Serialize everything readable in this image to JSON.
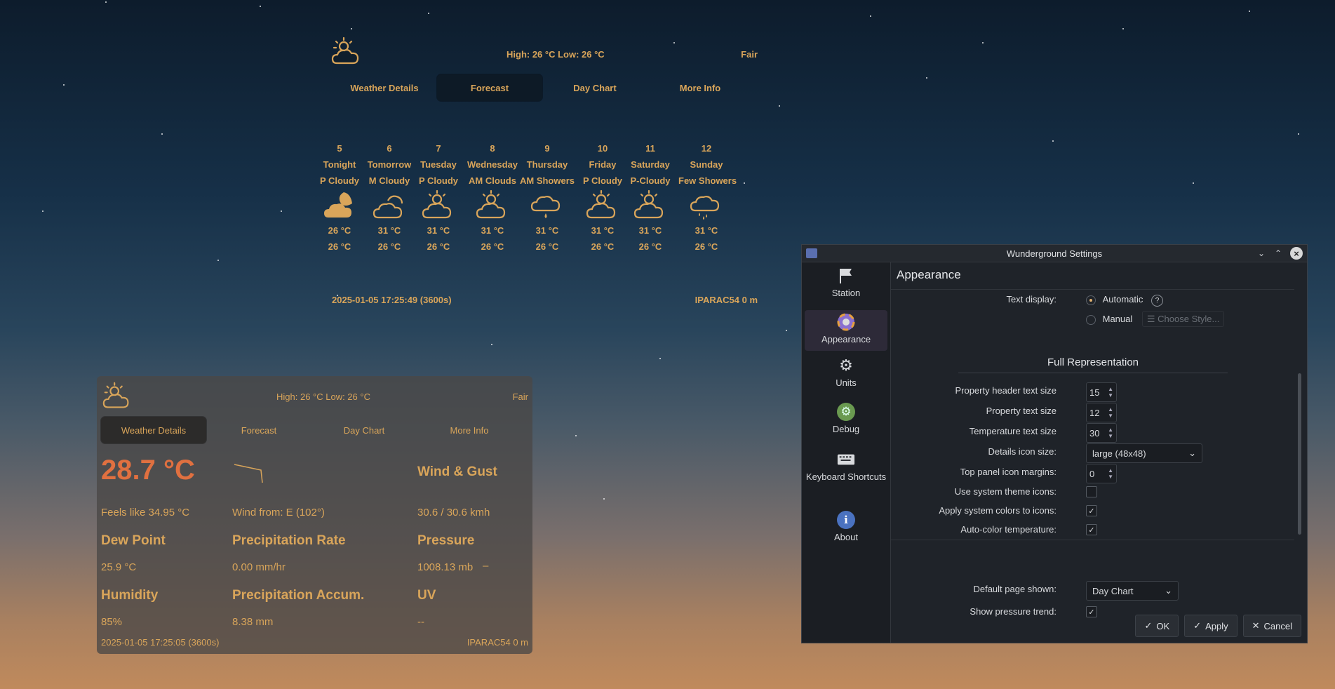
{
  "forecast_panel": {
    "hilo": "High: 26 °C Low: 26 °C",
    "condition": "Fair",
    "tabs": [
      "Weather Details",
      "Forecast",
      "Day Chart",
      "More Info"
    ],
    "active_tab": "Forecast",
    "days": [
      {
        "date": "5",
        "name": "Tonight",
        "cond": "P Cloudy",
        "icon": "moon-cloud-icon",
        "high": "26 °C",
        "low": "26 °C"
      },
      {
        "date": "6",
        "name": "Tomorrow",
        "cond": "M Cloudy",
        "icon": "clouds-icon",
        "high": "31 °C",
        "low": "26 °C"
      },
      {
        "date": "7",
        "name": "Tuesday",
        "cond": "P Cloudy",
        "icon": "sun-cloud-icon",
        "high": "31 °C",
        "low": "26 °C"
      },
      {
        "date": "8",
        "name": "Wednesday",
        "cond": "AM Clouds",
        "icon": "sun-cloud-icon",
        "high": "31 °C",
        "low": "26 °C"
      },
      {
        "date": "9",
        "name": "Thursday",
        "cond": "AM Showers",
        "icon": "rain-cloud-icon",
        "high": "31 °C",
        "low": "26 °C"
      },
      {
        "date": "10",
        "name": "Friday",
        "cond": "P Cloudy",
        "icon": "sun-cloud-icon",
        "high": "31 °C",
        "low": "26 °C"
      },
      {
        "date": "11",
        "name": "Saturday",
        "cond": "P-Cloudy",
        "icon": "sun-cloud-icon",
        "high": "31 °C",
        "low": "26 °C"
      },
      {
        "date": "12",
        "name": "Sunday",
        "cond": "Few Showers",
        "icon": "showers-cloud-icon",
        "high": "31 °C",
        "low": "26 °C"
      }
    ],
    "footer_time": "2025-01-05 17:25:49 (3600s)",
    "footer_station": "IPARAC54   0 m"
  },
  "details_panel": {
    "hilo": "High: 26 °C Low: 26 °C",
    "condition": "Fair",
    "tabs": [
      "Weather Details",
      "Forecast",
      "Day Chart",
      "More Info"
    ],
    "active_tab": "Weather Details",
    "temperature": "28.7 °C",
    "feels_like": "Feels like 34.95 °C",
    "wind_from": "Wind from: E (102°)",
    "wind_gust_label": "Wind & Gust",
    "wind_gust_value": "30.6 / 30.6 kmh",
    "dew_point_label": "Dew Point",
    "dew_point_value": "25.9 °C",
    "precip_rate_label": "Precipitation Rate",
    "precip_rate_value": "0.00 mm/hr",
    "pressure_label": "Pressure",
    "pressure_value": "1008.13 mb",
    "pressure_trend": "–",
    "humidity_label": "Humidity",
    "humidity_value": "85%",
    "precip_accum_label": "Precipitation Accum.",
    "precip_accum_value": "8.38 mm",
    "uv_label": "UV",
    "uv_value": "--",
    "footer_time": "2025-01-05 17:25:05 (3600s)",
    "footer_station": "IPARAC54   0 m"
  },
  "settings": {
    "title": "Wunderground Settings",
    "sidebar": [
      "Station",
      "Appearance",
      "Units",
      "Debug",
      "Keyboard Shortcuts",
      "About"
    ],
    "active": "Appearance",
    "page_title": "Appearance",
    "text_display_label": "Text display:",
    "automatic": "Automatic",
    "manual": "Manual",
    "choose_style": "Choose Style...",
    "section": "Full Representation",
    "rows": {
      "header_size_label": "Property header text size",
      "header_size": "15",
      "text_size_label": "Property text size",
      "text_size": "12",
      "temp_size_label": "Temperature text size",
      "temp_size": "30",
      "icon_size_label": "Details icon size:",
      "icon_size": "large (48x48)",
      "margins_label": "Top panel icon margins:",
      "margins": "0",
      "sys_icons_label": "Use system theme icons:",
      "sys_colors_label": "Apply system colors to icons:",
      "autocolor_label": "Auto-color temperature:",
      "default_page_label": "Default page shown:",
      "default_page": "Day Chart",
      "pressure_trend_label": "Show pressure trend:"
    },
    "buttons": {
      "ok": "OK",
      "apply": "Apply",
      "cancel": "Cancel"
    }
  }
}
